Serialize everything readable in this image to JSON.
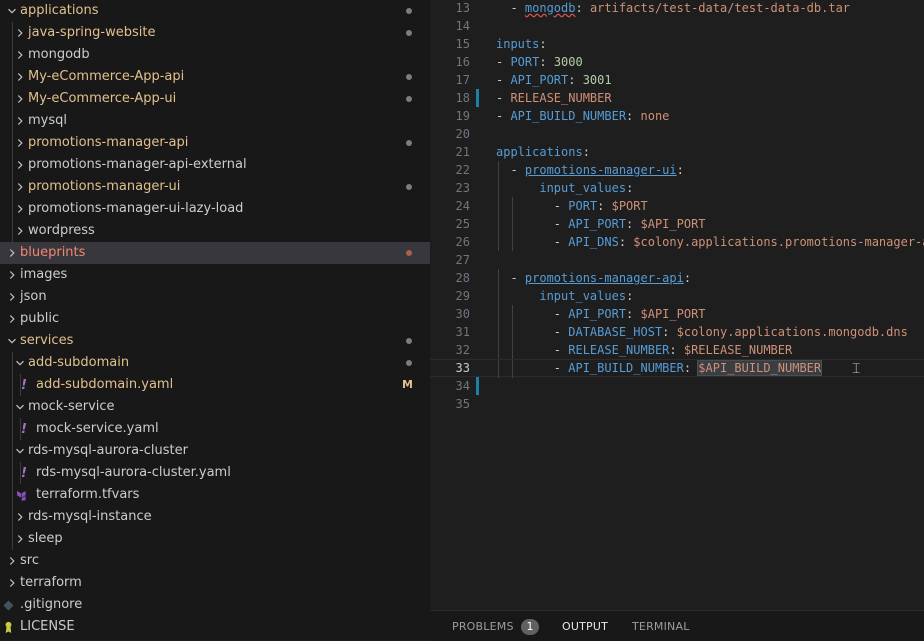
{
  "colors": {
    "folder_default": "#cccccc",
    "modified": "#e2c08d",
    "error": "#f48771",
    "dot_default": "#7d7d7d",
    "dot_error": "#a9604f",
    "yaml_icon": "#a074c4",
    "tf_icon": "#844fba",
    "git_icon": "#41535b",
    "license_icon": "#cbcb41",
    "gutter_modified": "#1b81a8"
  },
  "explorer": {
    "rows": [
      {
        "label": "applications",
        "chevron": "down",
        "color": "modified",
        "dot": "default"
      },
      {
        "label": "java-spring-website",
        "chevron": "right",
        "color": "modified",
        "dot": "default"
      },
      {
        "label": "mongodb",
        "chevron": "right",
        "color": "folder"
      },
      {
        "label": "My-eCommerce-App-api",
        "chevron": "right",
        "color": "modified",
        "dot": "default"
      },
      {
        "label": "My-eCommerce-App-ui",
        "chevron": "right",
        "color": "modified",
        "dot": "default"
      },
      {
        "label": "mysql",
        "chevron": "right",
        "color": "folder"
      },
      {
        "label": "promotions-manager-api",
        "chevron": "right",
        "color": "modified",
        "dot": "default"
      },
      {
        "label": "promotions-manager-api-external",
        "chevron": "right",
        "color": "folder"
      },
      {
        "label": "promotions-manager-ui",
        "chevron": "right",
        "color": "modified",
        "dot": "default"
      },
      {
        "label": "promotions-manager-ui-lazy-load",
        "chevron": "right",
        "color": "folder"
      },
      {
        "label": "wordpress",
        "chevron": "right",
        "color": "folder"
      },
      {
        "label": "blueprints",
        "chevron": "right",
        "color": "error",
        "dot": "error",
        "selected": true
      },
      {
        "label": "images",
        "chevron": "right",
        "color": "folder"
      },
      {
        "label": "json",
        "chevron": "right",
        "color": "folder"
      },
      {
        "label": "public",
        "chevron": "right",
        "color": "folder"
      },
      {
        "label": "services",
        "chevron": "down",
        "color": "modified",
        "dot": "default"
      },
      {
        "label": "add-subdomain",
        "chevron": "down",
        "color": "modified",
        "dot": "default"
      },
      {
        "label": "add-subdomain.yaml",
        "icon": "yaml-icon",
        "color": "modified",
        "badge": "M"
      },
      {
        "label": "mock-service",
        "chevron": "down",
        "color": "folder"
      },
      {
        "label": "mock-service.yaml",
        "icon": "yaml-icon",
        "color": "folder"
      },
      {
        "label": "rds-mysql-aurora-cluster",
        "chevron": "down",
        "color": "folder"
      },
      {
        "label": "rds-mysql-aurora-cluster.yaml",
        "icon": "yaml-icon",
        "color": "folder"
      },
      {
        "label": "terraform.tfvars",
        "icon": "terraform-icon",
        "color": "folder"
      },
      {
        "label": "rds-mysql-instance",
        "chevron": "right",
        "color": "folder"
      },
      {
        "label": "sleep",
        "chevron": "right",
        "color": "folder"
      },
      {
        "label": "src",
        "chevron": "right",
        "color": "folder"
      },
      {
        "label": "terraform",
        "chevron": "right",
        "color": "folder"
      },
      {
        "label": ".gitignore",
        "icon": "git-icon",
        "color": "folder"
      },
      {
        "label": "LICENSE",
        "icon": "license-icon",
        "color": "folder"
      }
    ]
  },
  "editor": {
    "active_line": "33",
    "lines": [
      {
        "num": "13",
        "tokens": [
          {
            "t": "  - ",
            "c": "dash"
          },
          {
            "t": "mongodb",
            "c": "key-squig"
          },
          {
            "t": ": ",
            "c": "plain"
          },
          {
            "t": "artifacts/test-data/test-data-db.tar",
            "c": "str"
          }
        ]
      },
      {
        "num": "14",
        "tokens": []
      },
      {
        "num": "15",
        "tokens": [
          {
            "t": "inputs",
            "c": "key"
          },
          {
            "t": ":",
            "c": "plain"
          }
        ]
      },
      {
        "num": "16",
        "tokens": [
          {
            "t": "- ",
            "c": "dash"
          },
          {
            "t": "PORT",
            "c": "key"
          },
          {
            "t": ": ",
            "c": "plain"
          },
          {
            "t": "3000",
            "c": "num"
          }
        ]
      },
      {
        "num": "17",
        "tokens": [
          {
            "t": "- ",
            "c": "dash"
          },
          {
            "t": "API_PORT",
            "c": "key"
          },
          {
            "t": ": ",
            "c": "plain"
          },
          {
            "t": "3001",
            "c": "num"
          }
        ]
      },
      {
        "num": "18",
        "modified": true,
        "tokens": [
          {
            "t": "- ",
            "c": "dash"
          },
          {
            "t": "RELEASE_NUMBER",
            "c": "str"
          }
        ]
      },
      {
        "num": "19",
        "tokens": [
          {
            "t": "- ",
            "c": "dash"
          },
          {
            "t": "API_BUILD_NUMBER",
            "c": "key"
          },
          {
            "t": ": ",
            "c": "plain"
          },
          {
            "t": "none",
            "c": "str"
          }
        ]
      },
      {
        "num": "20",
        "tokens": []
      },
      {
        "num": "21",
        "tokens": [
          {
            "t": "applications",
            "c": "key"
          },
          {
            "t": ":",
            "c": "plain"
          }
        ]
      },
      {
        "num": "22",
        "tokens": [
          {
            "t": "  - ",
            "c": "dash"
          },
          {
            "t": "promotions-manager-ui",
            "c": "key-ul"
          },
          {
            "t": ":",
            "c": "plain"
          }
        ]
      },
      {
        "num": "23",
        "tokens": [
          {
            "t": "      ",
            "c": "plain"
          },
          {
            "t": "input_values",
            "c": "key"
          },
          {
            "t": ":",
            "c": "plain"
          }
        ]
      },
      {
        "num": "24",
        "tokens": [
          {
            "t": "        - ",
            "c": "dash"
          },
          {
            "t": "PORT",
            "c": "key"
          },
          {
            "t": ": ",
            "c": "plain"
          },
          {
            "t": "$PORT",
            "c": "str"
          }
        ]
      },
      {
        "num": "25",
        "tokens": [
          {
            "t": "        - ",
            "c": "dash"
          },
          {
            "t": "API_PORT",
            "c": "key"
          },
          {
            "t": ": ",
            "c": "plain"
          },
          {
            "t": "$API_PORT",
            "c": "str"
          }
        ]
      },
      {
        "num": "26",
        "tokens": [
          {
            "t": "        - ",
            "c": "dash"
          },
          {
            "t": "API_DNS",
            "c": "key"
          },
          {
            "t": ": ",
            "c": "plain"
          },
          {
            "t": "$colony.applications.promotions-manager-a",
            "c": "str"
          }
        ]
      },
      {
        "num": "27",
        "tokens": []
      },
      {
        "num": "28",
        "tokens": [
          {
            "t": "  - ",
            "c": "dash"
          },
          {
            "t": "promotions-manager-api",
            "c": "key-ul"
          },
          {
            "t": ":",
            "c": "plain"
          }
        ]
      },
      {
        "num": "29",
        "tokens": [
          {
            "t": "      ",
            "c": "plain"
          },
          {
            "t": "input_values",
            "c": "key"
          },
          {
            "t": ":",
            "c": "plain"
          }
        ]
      },
      {
        "num": "30",
        "tokens": [
          {
            "t": "        - ",
            "c": "dash"
          },
          {
            "t": "API_PORT",
            "c": "key"
          },
          {
            "t": ": ",
            "c": "plain"
          },
          {
            "t": "$API_PORT",
            "c": "str"
          }
        ]
      },
      {
        "num": "31",
        "tokens": [
          {
            "t": "        - ",
            "c": "dash"
          },
          {
            "t": "DATABASE_HOST",
            "c": "key"
          },
          {
            "t": ": ",
            "c": "plain"
          },
          {
            "t": "$colony.applications.mongodb.dns",
            "c": "str"
          }
        ]
      },
      {
        "num": "32",
        "tokens": [
          {
            "t": "        - ",
            "c": "dash"
          },
          {
            "t": "RELEASE_NUMBER",
            "c": "key"
          },
          {
            "t": ": ",
            "c": "plain"
          },
          {
            "t": "$RELEASE_NUMBER",
            "c": "str"
          }
        ]
      },
      {
        "num": "33",
        "current": true,
        "tokens": [
          {
            "t": "        - ",
            "c": "dash"
          },
          {
            "t": "API_BUILD_NUMBER",
            "c": "key"
          },
          {
            "t": ": ",
            "c": "plain"
          },
          {
            "t": "$API_BUILD_NUMBER",
            "c": "sel"
          }
        ]
      },
      {
        "num": "34",
        "modified": true,
        "tokens": []
      },
      {
        "num": "35",
        "tokens": []
      }
    ]
  },
  "panel": {
    "tabs": [
      {
        "label": "PROBLEMS",
        "badge": "1"
      },
      {
        "label": "OUTPUT",
        "active": true
      },
      {
        "label": "TERMINAL"
      }
    ]
  }
}
